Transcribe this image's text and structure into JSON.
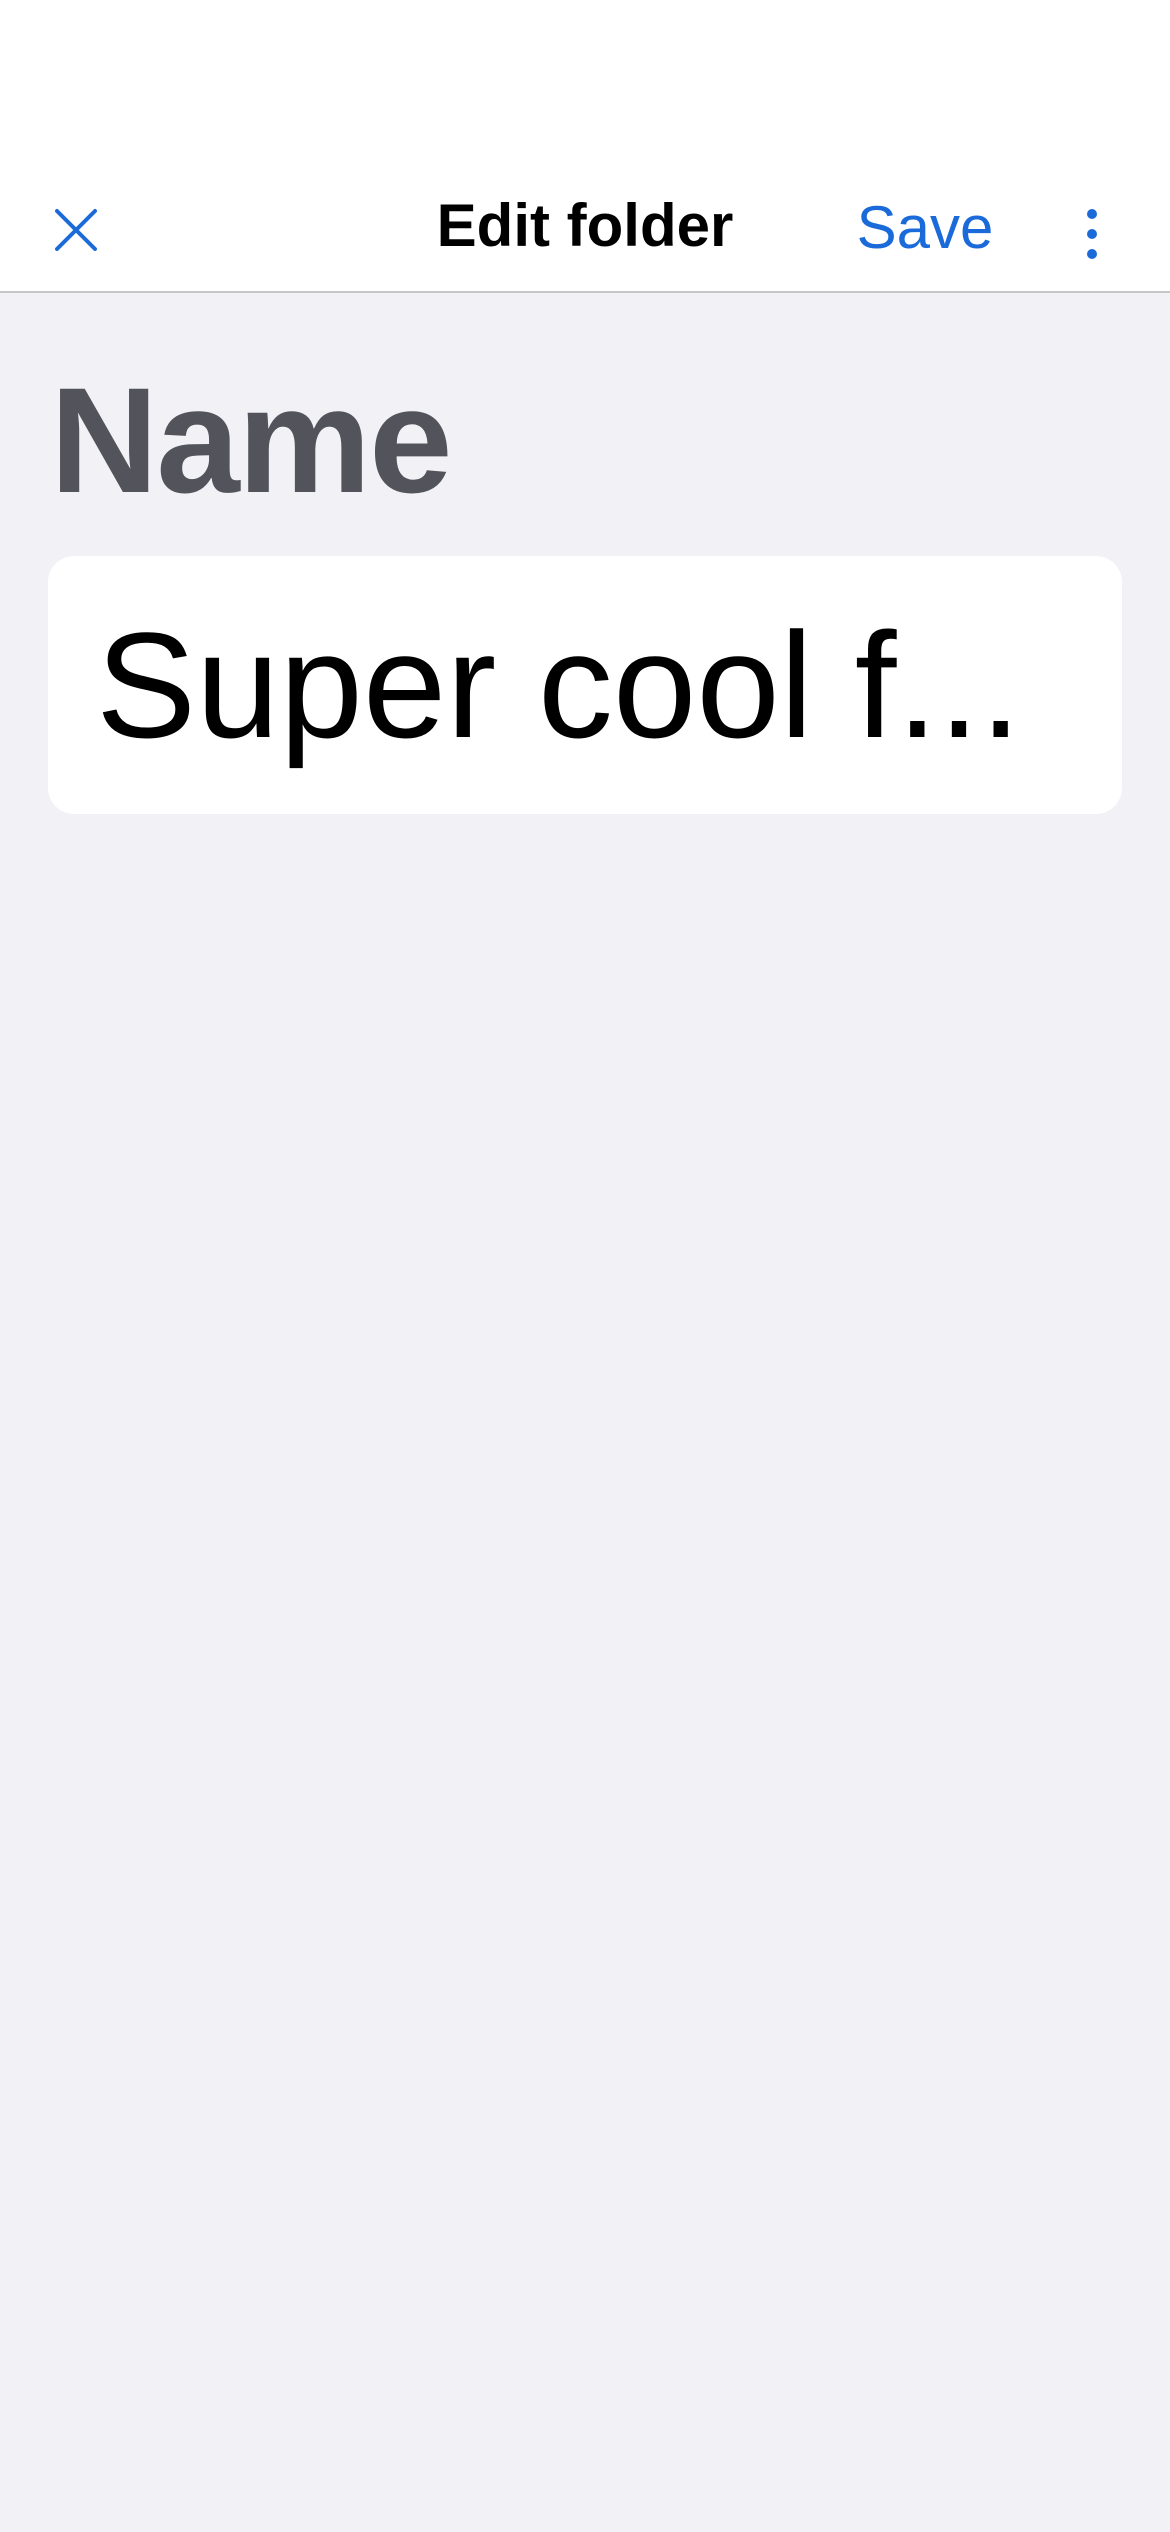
{
  "nav": {
    "title": "Edit folder",
    "save_label": "Save",
    "close_icon": "close-icon",
    "more_icon": "more-vertical-icon"
  },
  "form": {
    "name_label": "Name",
    "name_value": "Super cool f..."
  },
  "colors": {
    "accent": "#1a6bd9",
    "background": "#f1f1f6",
    "label": "#53545b"
  }
}
